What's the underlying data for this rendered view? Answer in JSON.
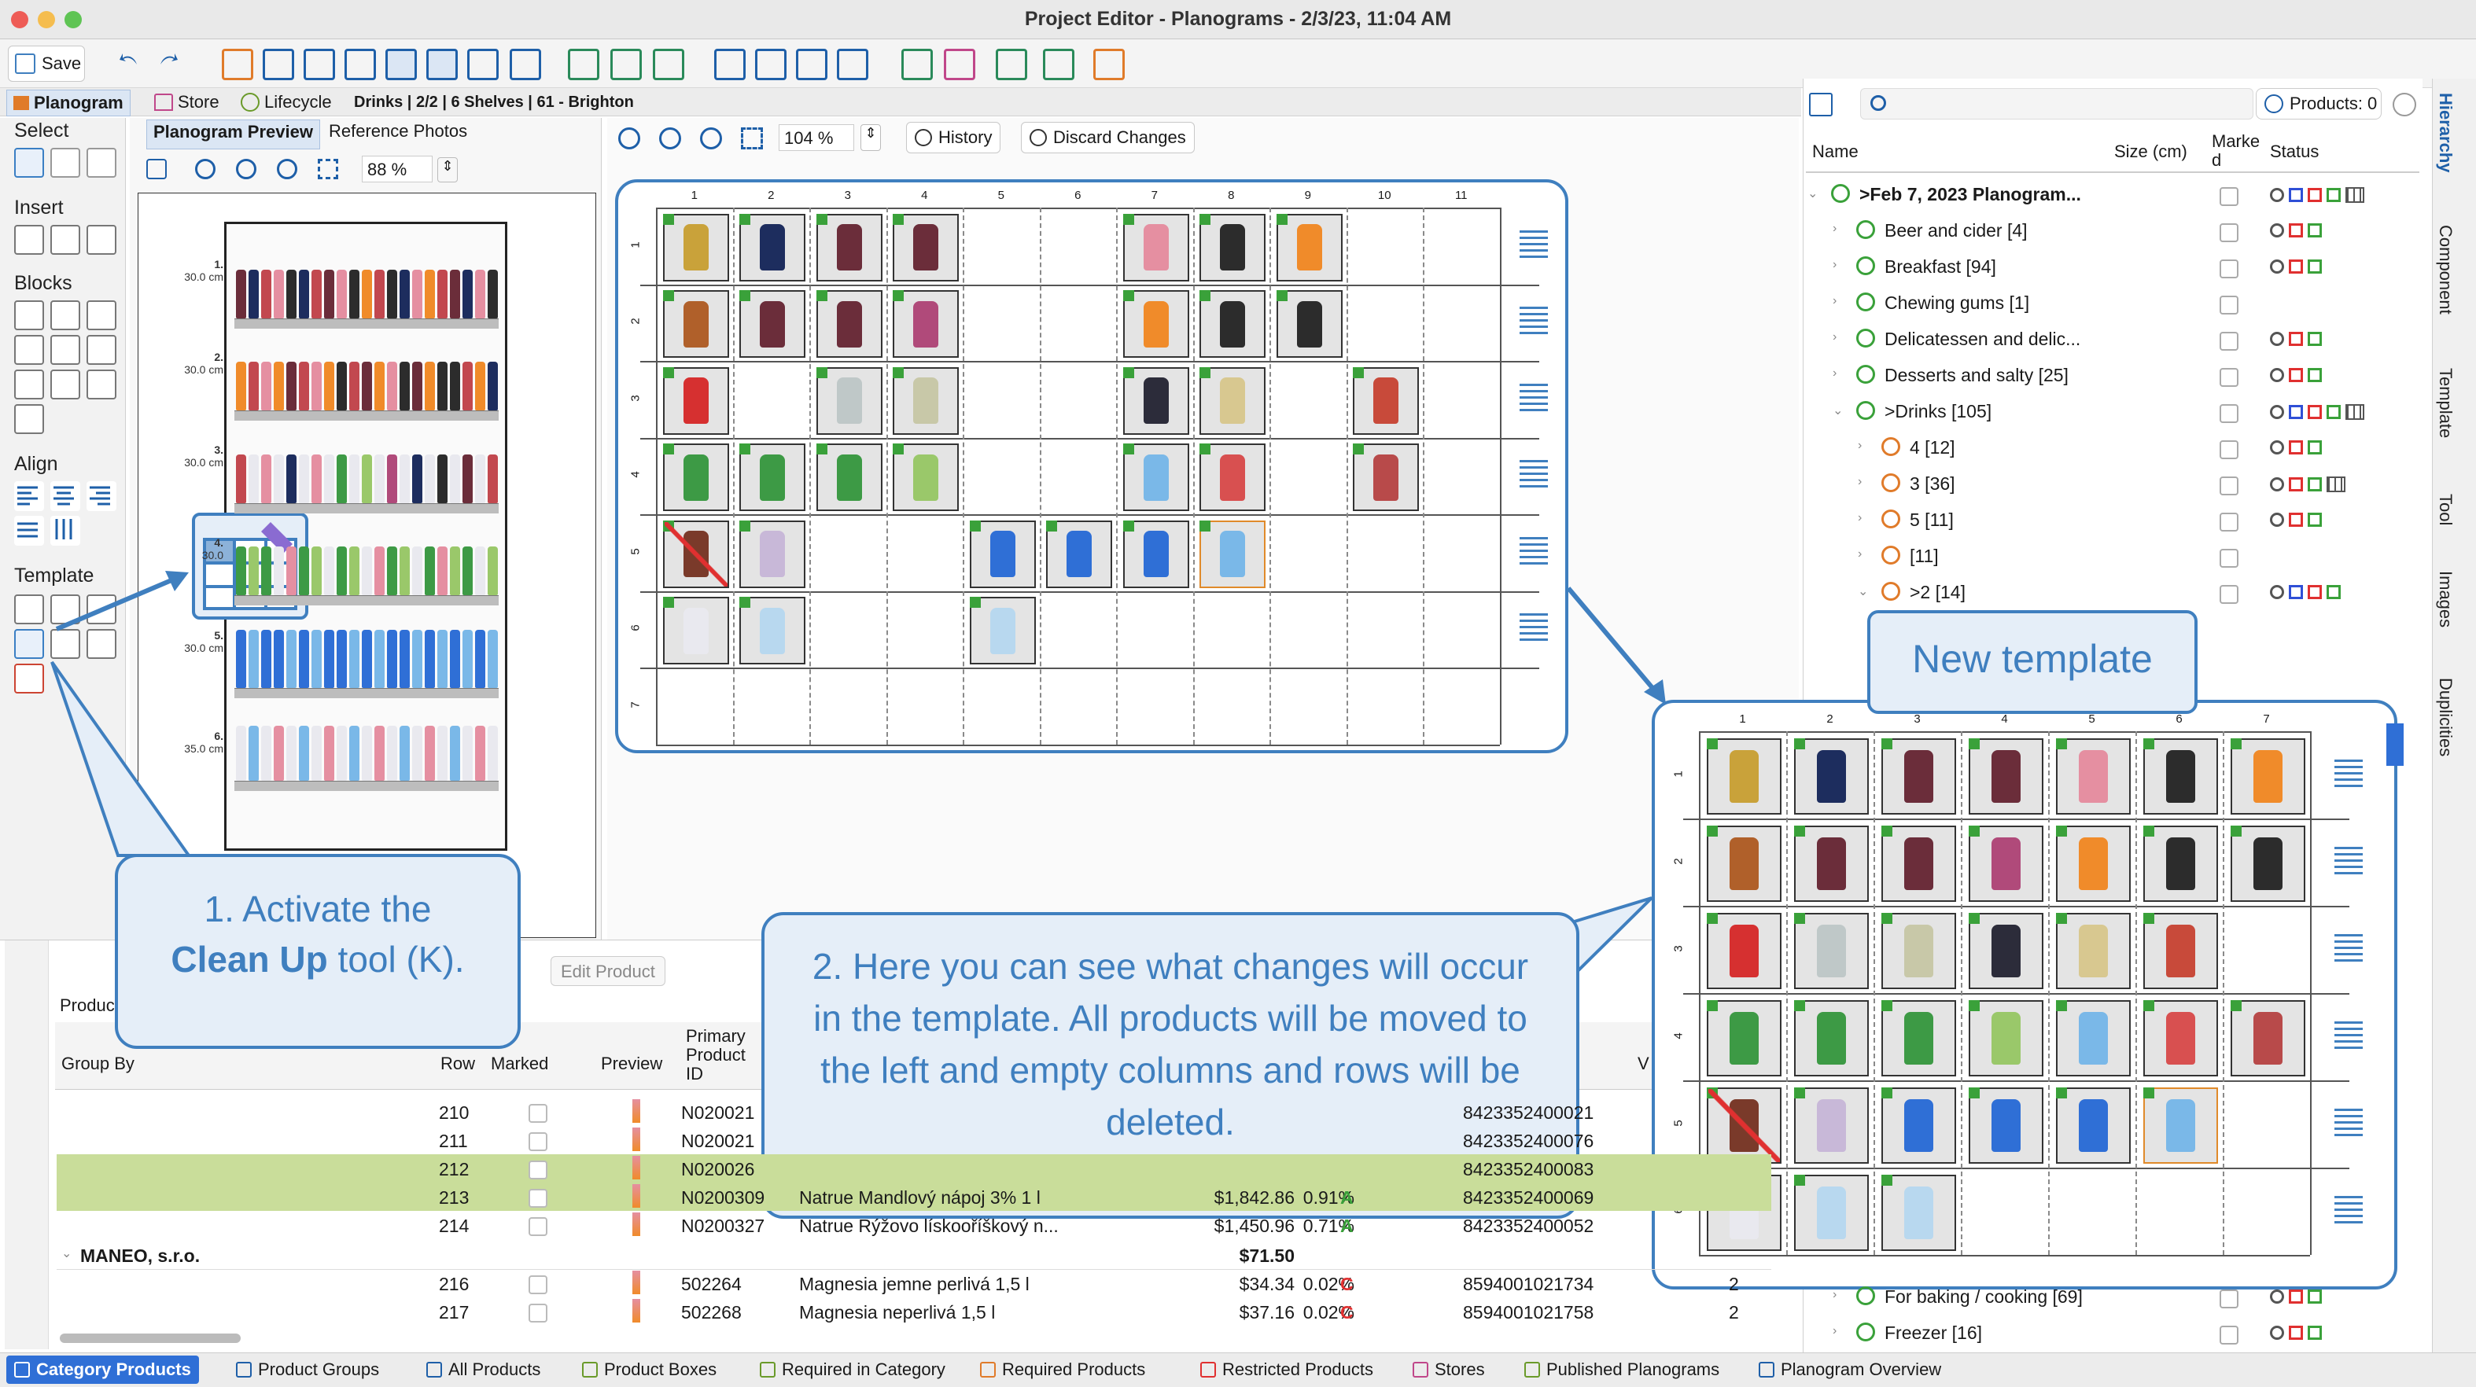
{
  "window": {
    "title": "Project Editor - Planograms - 2/3/23, 11:04 AM"
  },
  "toolbar": {
    "save_label": "Save"
  },
  "tabs": {
    "planogram": "Planogram",
    "store": "Store",
    "lifecycle": "Lifecycle",
    "breadcrumb": "Drinks | 2/2 | 6 Shelves | 61 - Brighton"
  },
  "left_panel": {
    "sections": [
      "Select",
      "Insert",
      "Blocks",
      "Align",
      "Template"
    ]
  },
  "preview": {
    "tab_preview": "Planogram Preview",
    "tab_photos": "Reference Photos",
    "zoom": "88 %",
    "shelves": [
      {
        "num": "1.",
        "height": "30.0 cm"
      },
      {
        "num": "2.",
        "height": "30.0 cm"
      },
      {
        "num": "3.",
        "height": "30.0 cm"
      },
      {
        "num": "4.",
        "height": "30.0"
      },
      {
        "num": "5.",
        "height": "30.0 cm"
      },
      {
        "num": "6.",
        "height": "35.0 cm"
      }
    ]
  },
  "grid_panel": {
    "zoom": "104 %",
    "history": "History",
    "discard": "Discard Changes",
    "columns": [
      "1",
      "2",
      "3",
      "4",
      "5",
      "6",
      "7",
      "8",
      "9",
      "10",
      "11"
    ],
    "rows": [
      "1",
      "2",
      "3",
      "4",
      "5",
      "6",
      "7"
    ]
  },
  "template_panel": {
    "title": "New template",
    "columns": [
      "1",
      "2",
      "3",
      "4",
      "5",
      "6",
      "7"
    ],
    "rows": [
      "1",
      "2",
      "3",
      "4",
      "5",
      "6"
    ]
  },
  "hierarchy": {
    "products_count": "Products: 0",
    "col_name": "Name",
    "col_size": "Size (cm)",
    "col_marked": "Marked",
    "col_status": "Status",
    "rows": [
      {
        "label": ">Feb 7, 2023 Planogram...",
        "bold": true
      },
      {
        "label": "Beer and cider [4]"
      },
      {
        "label": "Breakfast [94]"
      },
      {
        "label": "Chewing gums [1]"
      },
      {
        "label": "Delicatessen and delic..."
      },
      {
        "label": "Desserts and salty [25]"
      },
      {
        "label": ">Drinks [105]"
      },
      {
        "label": "4 [12]"
      },
      {
        "label": "3 [36]"
      },
      {
        "label": "5 [11]"
      },
      {
        "label": "[11]"
      },
      {
        "label": ">2 [14]"
      },
      {
        "label": "For baking / cooking [69]"
      },
      {
        "label": "Freezer [16]"
      }
    ]
  },
  "side_tabs": [
    "Hierarchy",
    "Component",
    "Template",
    "Tool",
    "Images",
    "Duplicities"
  ],
  "bottom": {
    "edit_product": "Edit Product",
    "products_tab": "Produc",
    "headers": {
      "group_by": "Group By",
      "row": "Row",
      "marked": "Marked",
      "preview": "Preview",
      "primary_id": "Primary Product ID",
      "v": "V"
    },
    "rows": [
      {
        "row": "210",
        "id": "N020021",
        "name": "",
        "price": "",
        "pct": "",
        "grade": "",
        "ean": "8423352400021",
        "qty": "",
        "highlight": false
      },
      {
        "row": "211",
        "id": "N020021",
        "name": "",
        "price": "",
        "pct": "",
        "grade": "",
        "ean": "8423352400076",
        "qty": "",
        "highlight": false
      },
      {
        "row": "212",
        "id": "N020026",
        "name": "",
        "price": "",
        "pct": "",
        "grade": "",
        "ean": "8423352400083",
        "qty": "",
        "highlight": true
      },
      {
        "row": "213",
        "id": "N0200309",
        "name": "Natrue Mandlový nápoj 3% 1 l",
        "price": "$1,842.86",
        "pct": "0.91%",
        "grade": "A",
        "ean": "8423352400069",
        "qty": "",
        "highlight": true
      },
      {
        "row": "214",
        "id": "N0200327",
        "name": "Natrue Rýžovo lískooříškový n...",
        "price": "$1,450.96",
        "pct": "0.71%",
        "grade": "A",
        "ean": "8423352400052",
        "qty": "",
        "highlight": false
      }
    ],
    "group": {
      "name": "MANEO, s.r.o.",
      "price": "$71.50"
    },
    "rows2": [
      {
        "row": "216",
        "id": "502264",
        "name": "Magnesia jemne perlivá 1,5 l",
        "price": "$34.34",
        "pct": "0.02%",
        "grade": "C",
        "ean": "8594001021734",
        "qty": "2"
      },
      {
        "row": "217",
        "id": "502268",
        "name": "Magnesia neperlivá 1,5 l",
        "price": "$37.16",
        "pct": "0.02%",
        "grade": "C",
        "ean": "8594001021758",
        "qty": "2"
      }
    ]
  },
  "status_tabs": [
    "Category Products",
    "Product Groups",
    "All Products",
    "Product Boxes",
    "Required in Category",
    "Required Products",
    "Restricted Products",
    "Stores",
    "Published Planograms",
    "Planogram Overview"
  ],
  "callouts": {
    "one_a": "1. Activate the",
    "one_b": "Clean Up",
    "one_c": " tool (K).",
    "two": "2. Here you can see what changes will occur in the template. All products will be moved to the left and empty columns and rows will be deleted."
  },
  "colors": {
    "accent": "#3f7fbf",
    "highlight_row": "#c9dd9a",
    "flag": "#3aa13a"
  }
}
